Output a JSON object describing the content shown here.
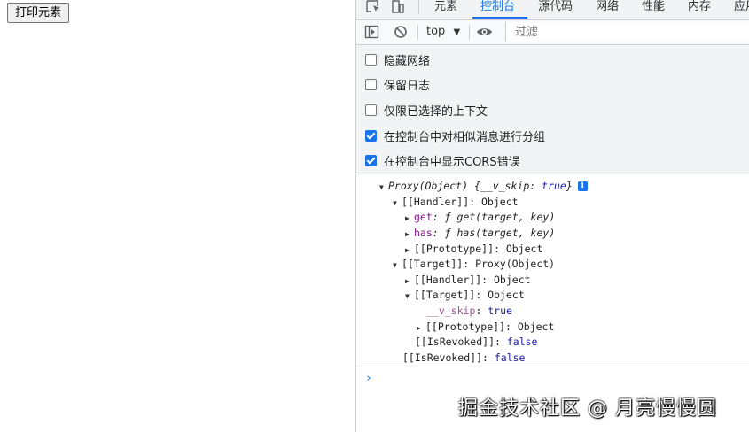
{
  "page": {
    "print_button": "打印元素"
  },
  "devtools": {
    "tabs": [
      {
        "label": "元素"
      },
      {
        "label": "控制台"
      },
      {
        "label": "源代码"
      },
      {
        "label": "网络"
      },
      {
        "label": "性能"
      },
      {
        "label": "内存"
      },
      {
        "label": "应用"
      }
    ],
    "active_tab_color": "#1a73e8",
    "toolbar": {
      "context": "top",
      "filter_placeholder": "过滤"
    },
    "settings": [
      {
        "label": "隐藏网络",
        "checked": false
      },
      {
        "label": "保留日志",
        "checked": false
      },
      {
        "label": "仅限已选择的上下文",
        "checked": false
      },
      {
        "label": "在控制台中对相似消息进行分组",
        "checked": true
      },
      {
        "label": "在控制台中显示CORS错误",
        "checked": true
      }
    ],
    "console": {
      "l1_a": "Proxy(Object) ",
      "l1_b": "{__v_skip: ",
      "l1_c": "true",
      "l1_d": "}",
      "info": "i",
      "l2": "[[Handler]]: Object",
      "l3_k": "get",
      "l3_v": ": ƒ get(target, key)",
      "l4_k": "has",
      "l4_v": ": ƒ has(target, key)",
      "l5": "[[Prototype]]: Object",
      "l6": "[[Target]]: Proxy(Object)",
      "l7": "[[Handler]]: Object",
      "l8": "[[Target]]: Object",
      "l9_k": "__v_skip",
      "l9_v": "true",
      "l10": "[[Prototype]]: Object",
      "l11_k": "[[IsRevoked]]: ",
      "l11_v": "false",
      "l12_k": "[[IsRevoked]]: ",
      "l12_v": "false",
      "prompt": "›"
    }
  },
  "watermark": "掘金技术社区 @ 月亮慢慢圆"
}
